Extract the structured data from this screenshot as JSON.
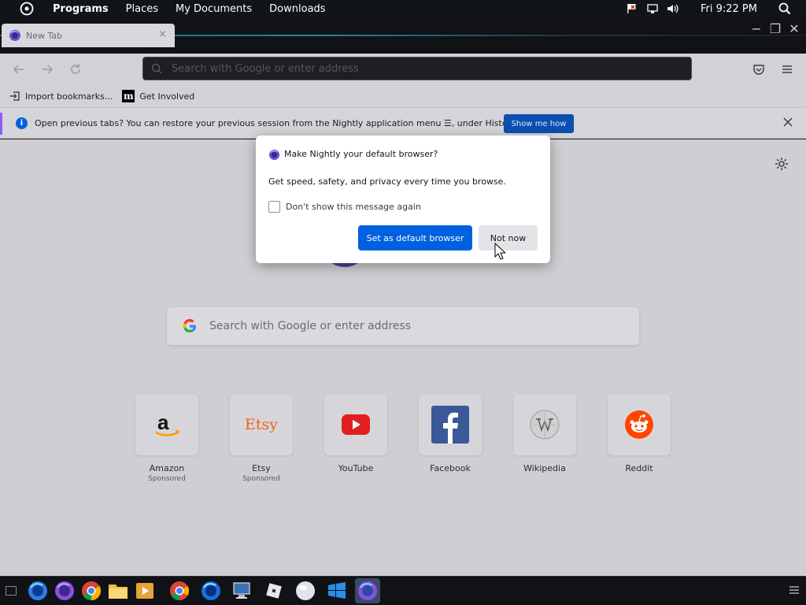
{
  "top_panel": {
    "menus": [
      "Programs",
      "Places",
      "My Documents",
      "Downloads"
    ],
    "clock": "Fri 9:22 PM"
  },
  "tab": {
    "title": "New Tab",
    "close": "×"
  },
  "window_controls": {
    "minimize": "−",
    "restore": "❐",
    "close": "✕"
  },
  "urlbar": {
    "placeholder": "Search with Google or enter address"
  },
  "bookmarks": [
    {
      "label": "Import bookmarks..."
    },
    {
      "label": "Get Involved"
    }
  ],
  "notification": {
    "message": "Open previous tabs? You can restore your previous session from the Nightly application menu ☰, under History.",
    "button": "Show me how"
  },
  "newtab": {
    "search_placeholder": "Search with Google or enter address",
    "top_sites": [
      {
        "name": "Amazon",
        "sponsored": "Sponsored",
        "icon": "amazon-icon"
      },
      {
        "name": "Etsy",
        "sponsored": "Sponsored",
        "icon": "etsy-icon",
        "logo_text": "Etsy"
      },
      {
        "name": "YouTube",
        "sponsored": "",
        "icon": "youtube-icon"
      },
      {
        "name": "Facebook",
        "sponsored": "",
        "icon": "facebook-icon"
      },
      {
        "name": "Wikipedia",
        "sponsored": "",
        "icon": "wikipedia-icon"
      },
      {
        "name": "Reddit",
        "sponsored": "",
        "icon": "reddit-icon"
      }
    ]
  },
  "dialog": {
    "title": "Make Nightly your default browser?",
    "body": "Get speed, safety, and privacy every time you browse.",
    "checkbox_label": "Don't show this message again",
    "primary_button": "Set as default browser",
    "secondary_button": "Not now"
  },
  "taskbar": {
    "icons": [
      "firefox-icon",
      "firefox-nightly-icon",
      "chrome-icon",
      "file-manager-icon",
      "media-player-icon",
      "chrome-icon",
      "firefox-icon",
      "computer-icon",
      "roblox-icon",
      "ball-icon",
      "windows-icon",
      "firefox-nightly-icon"
    ]
  },
  "colors": {
    "accent_blue": "#0061e0",
    "nightly_purple": "#9059ff"
  }
}
